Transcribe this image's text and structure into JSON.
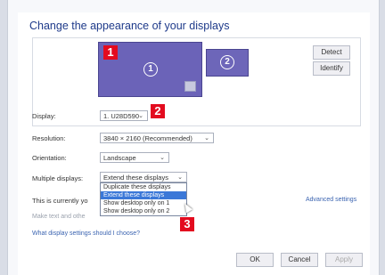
{
  "title": "Change the appearance of your displays",
  "monitors": [
    {
      "label": "1"
    },
    {
      "label": "2"
    }
  ],
  "buttons": {
    "detect": "Detect",
    "identify": "Identify",
    "ok": "OK",
    "cancel": "Cancel",
    "apply": "Apply"
  },
  "badges": [
    "1",
    "2",
    "3"
  ],
  "settings": {
    "display_label": "Display:",
    "display_value": "1. U28D590",
    "resolution_label": "Resolution:",
    "resolution_value": "3840 × 2160 (Recommended)",
    "orientation_label": "Orientation:",
    "orientation_value": "Landscape",
    "multiple_label": "Multiple displays:",
    "multiple_value": "Extend these displays"
  },
  "dropdown_options": [
    "Duplicate these displays",
    "Extend these displays",
    "Show desktop only on 1",
    "Show desktop only on 2"
  ],
  "current_text": "This is currently yo",
  "advanced_link": "Advanced settings",
  "make_text_link": "Make text and othe",
  "what_link": "What display settings should I choose?",
  "colors": {
    "accent": "#6b63b8",
    "badge": "#e30b1f",
    "selected": "#3b78d8"
  }
}
